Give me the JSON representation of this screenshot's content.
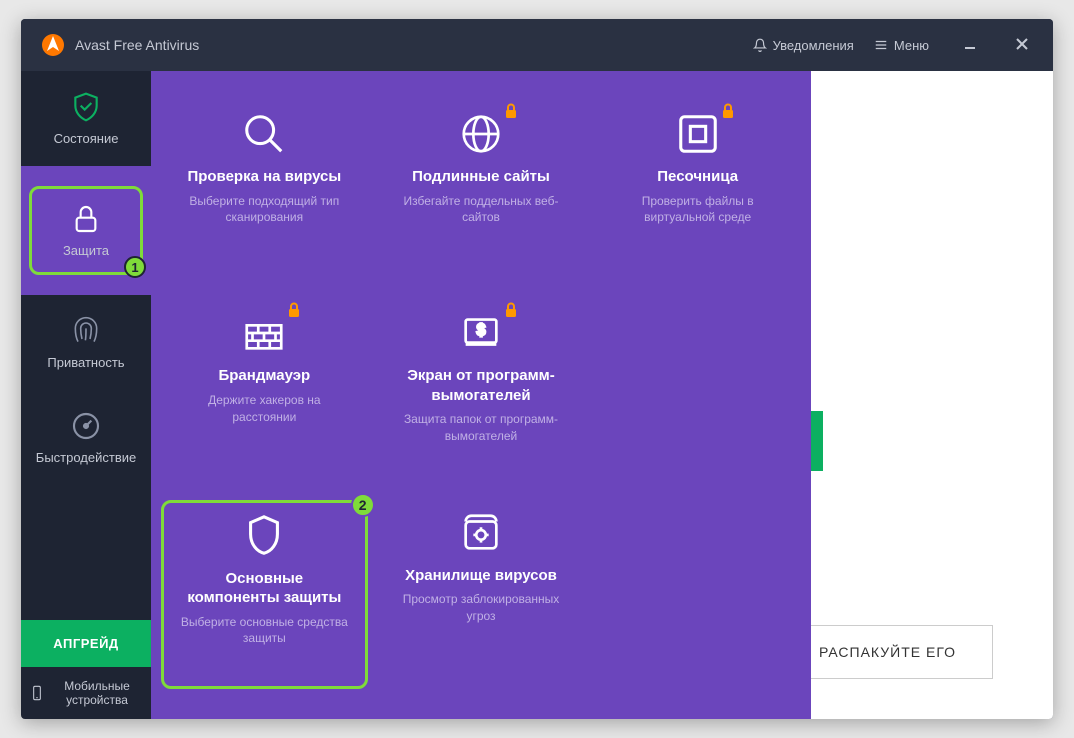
{
  "app": {
    "title": "Avast Free Antivirus"
  },
  "header": {
    "notifications": "Уведомления",
    "menu": "Меню"
  },
  "sidebar": {
    "items": [
      {
        "label": "Состояние"
      },
      {
        "label": "Защита",
        "badge": "1"
      },
      {
        "label": "Приватность"
      },
      {
        "label": "Быстродействие"
      }
    ],
    "upgrade": "АПГРЕЙД",
    "mobile": "Мобильные устройства"
  },
  "tiles": [
    {
      "title": "Проверка на вирусы",
      "desc": "Выберите подходящий тип сканирования",
      "locked": false
    },
    {
      "title": "Подлинные сайты",
      "desc": "Избегайте поддельных веб-сайтов",
      "locked": true
    },
    {
      "title": "Песочница",
      "desc": "Проверить файлы в виртуальной среде",
      "locked": true
    },
    {
      "title": "Брандмауэр",
      "desc": "Держите хакеров на расстоянии",
      "locked": true
    },
    {
      "title": "Экран от программ-вымогателей",
      "desc": "Защита папок от программ-вымогателей",
      "locked": true
    },
    {
      "title": "Основные компоненты защиты",
      "desc": "Выберите основные средства защиты",
      "locked": false,
      "badge": "2"
    },
    {
      "title": "Хранилище вирусов",
      "desc": "Просмотр заблокированных угроз",
      "locked": false
    }
  ],
  "main": {
    "unpack_button": "РАСПАКУЙТЕ ЕГО"
  }
}
